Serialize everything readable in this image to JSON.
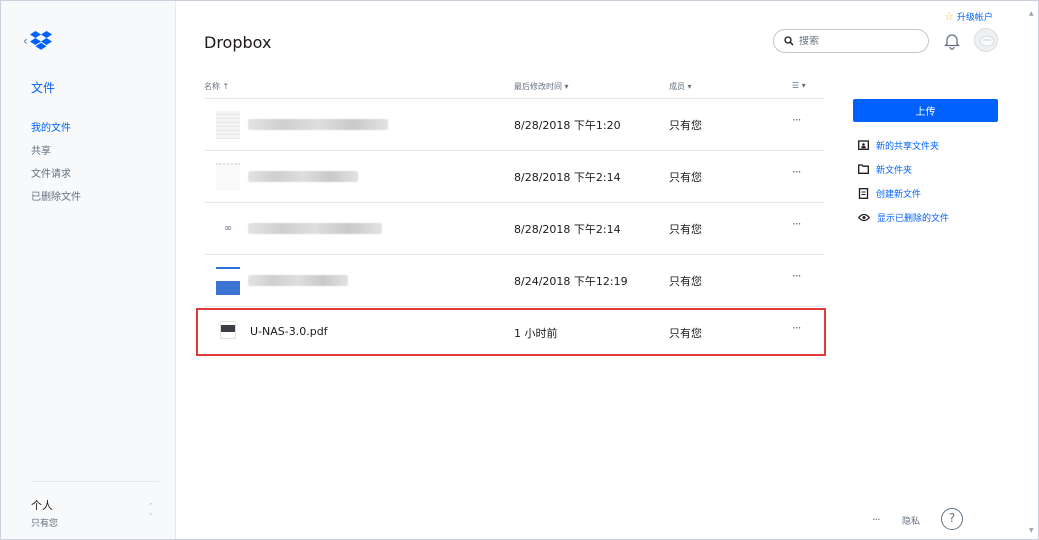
{
  "colors": {
    "accent": "#0061fe",
    "highlight": "#e03a3a",
    "sidebar_bg": "#f7f9fa"
  },
  "sidebar": {
    "back_icon": "chevron-left-icon",
    "logo": "dropbox-logo",
    "section_title": "文件",
    "items": [
      {
        "label": "我的文件",
        "active": true
      },
      {
        "label": "共享",
        "active": false
      },
      {
        "label": "文件请求",
        "active": false
      },
      {
        "label": "已删除文件",
        "active": false
      }
    ],
    "account": {
      "name": "个人",
      "sub": "只有您"
    }
  },
  "header": {
    "title": "Dropbox",
    "upgrade_label": "升级帐户",
    "search_placeholder": "搜索",
    "icons": [
      "search-icon",
      "bell-icon",
      "avatar"
    ]
  },
  "table": {
    "columns": {
      "name": "名称 ↑",
      "modified": "最后修改时间 ▾",
      "members": "成员 ▾",
      "view": "☰ ▾"
    },
    "rows": [
      {
        "name": "",
        "modified": "8/28/2018 下午1:20",
        "members": "只有您",
        "more": "···",
        "blurred": true
      },
      {
        "name": "",
        "modified": "8/28/2018 下午2:14",
        "members": "只有您",
        "more": "···",
        "blurred": true
      },
      {
        "name": "",
        "modified": "8/28/2018 下午2:14",
        "members": "只有您",
        "more": "···",
        "blurred": true
      },
      {
        "name": "",
        "modified": "8/24/2018 下午12:19",
        "members": "只有您",
        "more": "···",
        "blurred": true
      },
      {
        "name": "U-NAS-3.0.pdf",
        "modified": "1 小时前",
        "members": "只有您",
        "more": "···",
        "blurred": false
      }
    ]
  },
  "right_panel": {
    "upload_label": "上传",
    "actions": [
      {
        "icon": "shared-folder-icon",
        "label": "新的共享文件夹"
      },
      {
        "icon": "folder-icon",
        "label": "新文件夹"
      },
      {
        "icon": "new-file-icon",
        "label": "创建新文件"
      },
      {
        "icon": "eye-icon",
        "label": "显示已删除的文件"
      }
    ]
  },
  "footer": {
    "more": "···",
    "privacy": "隐私",
    "help": "?"
  }
}
